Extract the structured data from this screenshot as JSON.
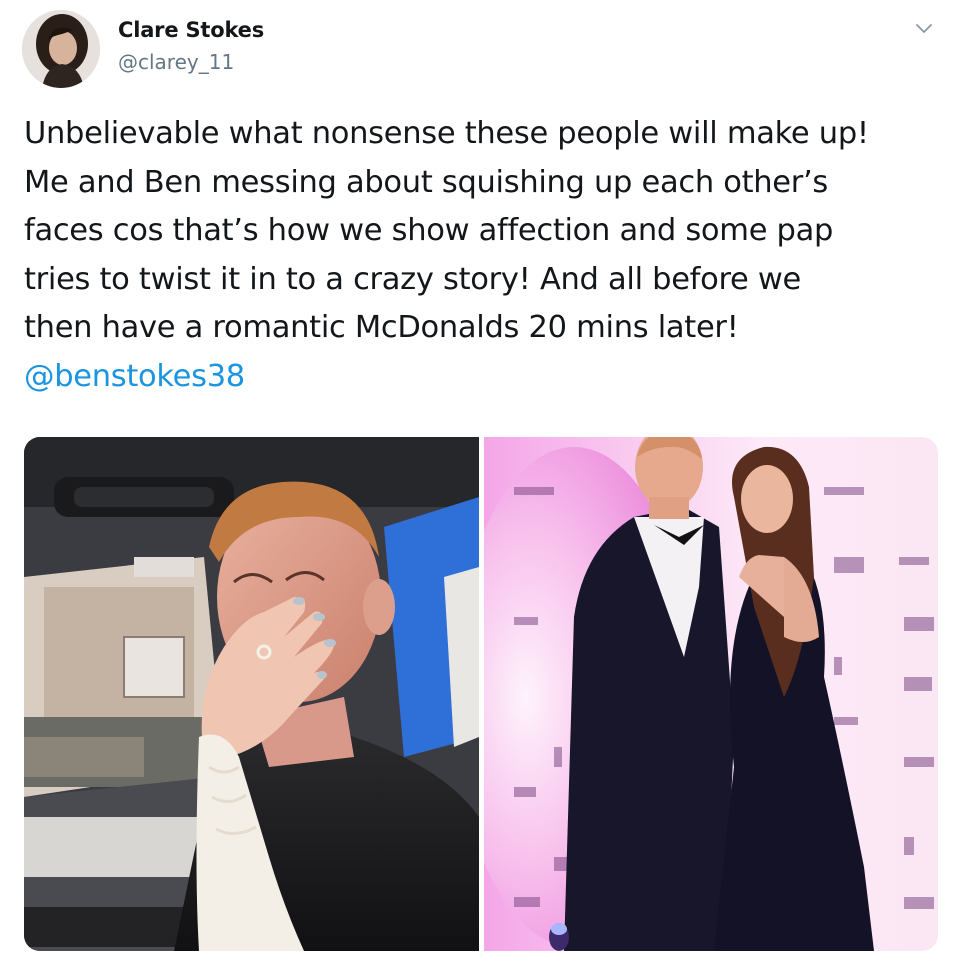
{
  "author": {
    "display_name": "Clare Stokes",
    "handle": "@clarey_11"
  },
  "tweet": {
    "lines": [
      "Unbelievable what nonsense these people will make up!",
      "Me and Ben messing about squishing up each other’s",
      "faces cos that’s how we show affection and some pap",
      "tries to twist it in to a crazy story! And all before we",
      "then have a romantic McDonalds 20 mins later!"
    ],
    "mention": "@benstokes38"
  },
  "media": {
    "left_photo": "car-selfie-photo",
    "right_photo": "red-carpet-photo",
    "backdrop_logos": [
      "Vitality",
      "PCA",
      "IPA",
      "PCA",
      "PCA",
      "PCA",
      "PCA"
    ]
  },
  "icons": {
    "more": "chevron-down-icon"
  },
  "colors": {
    "text": "#14171a",
    "secondary": "#657786",
    "link": "#1b95e0",
    "backdrop": "#ffffff"
  }
}
